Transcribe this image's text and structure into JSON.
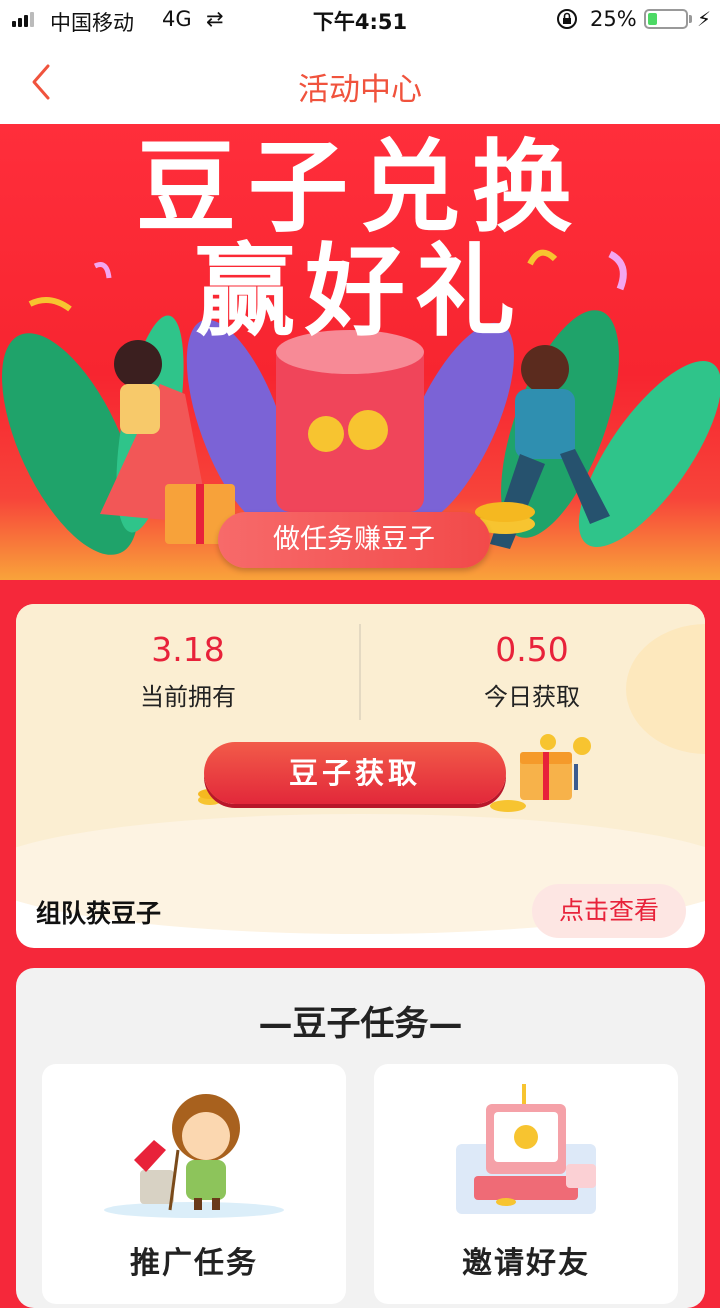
{
  "status_bar": {
    "carrier": "中国移动",
    "network": "4G",
    "time": "下午4:51",
    "battery_percent": "25%",
    "battery_level": 0.25
  },
  "nav": {
    "title": "活动中心",
    "back_icon": "chevron-left-icon"
  },
  "banner": {
    "title_line1": "豆子兑换",
    "title_line2": "赢好礼",
    "cta_label": "做任务赚豆子"
  },
  "beans": {
    "current_value": "3.18",
    "current_label": "当前拥有",
    "today_value": "0.50",
    "today_label": "今日获取",
    "get_button": "豆子获取"
  },
  "team": {
    "label": "组队获豆子",
    "view_button": "点击查看"
  },
  "tasks": {
    "heading": "—豆子任务—",
    "items": [
      {
        "label": "推广任务",
        "icon": "cleaner-illustration"
      },
      {
        "label": "邀请好友",
        "icon": "invite-illustration"
      }
    ]
  },
  "colors": {
    "accent_red": "#e8223a",
    "banner_red": "#f72530",
    "nav_title": "#f0533d",
    "card_cream": "#fbeed2"
  }
}
